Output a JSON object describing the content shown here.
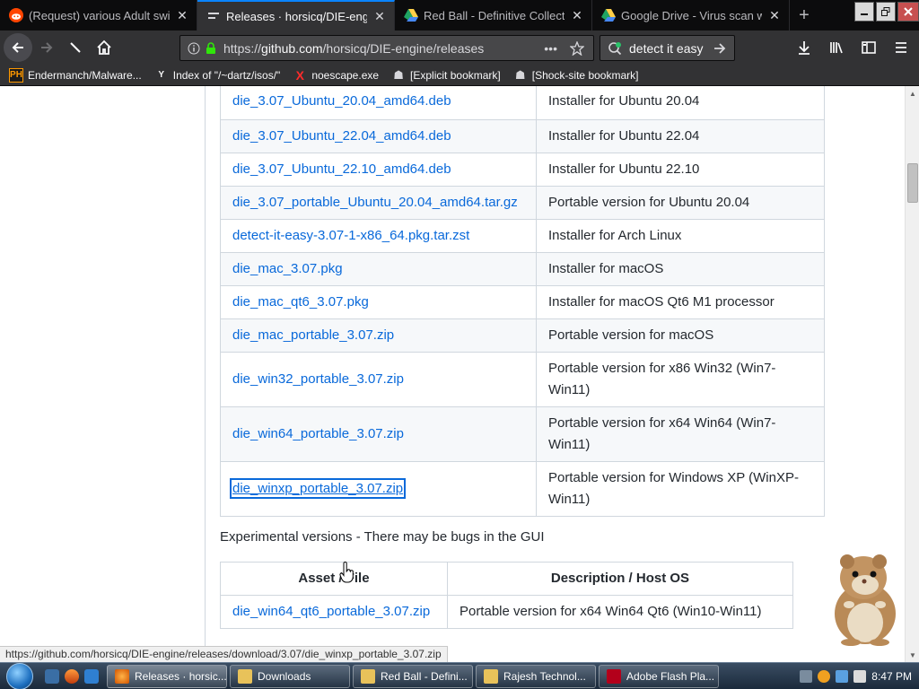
{
  "tabs": [
    {
      "title": "(Request) various Adult swim",
      "active": false,
      "icon": "reddit-icon"
    },
    {
      "title": "Releases · horsicq/DIE-engine",
      "active": true,
      "icon": "github-icon"
    },
    {
      "title": "Red Ball - Definitive Collectio",
      "active": false,
      "icon": "google-drive-icon"
    },
    {
      "title": "Google Drive - Virus scan war",
      "active": false,
      "icon": "google-drive-icon"
    }
  ],
  "tab_close_glyph": "✕",
  "new_tab_glyph": "+",
  "nav": {
    "url_prefix": "https://",
    "url_host": "github.com",
    "url_path": "/horsicq/DIE-engine/releases",
    "search_text": "detect it easy",
    "page_actions_glyph": "•••"
  },
  "bookmarks": [
    {
      "label": "Endermanch/Malware...",
      "icon": "pornhub-style-icon",
      "icon_text": "PH"
    },
    {
      "label": "Index of \"/~dartz/isos/\"",
      "icon": "y-icon",
      "icon_text": "Y"
    },
    {
      "label": "noescape.exe",
      "icon": "red-x-icon",
      "icon_text": "X"
    },
    {
      "label": "[Explicit bookmark]",
      "icon": "bookmark-icon",
      "icon_text": "☗"
    },
    {
      "label": "[Shock-site bookmark]",
      "icon": "bookmark-icon",
      "icon_text": "☗"
    }
  ],
  "assets_table": {
    "rows": [
      {
        "file": "die_3.07_Ubuntu_20.04_amd64.deb",
        "desc": "Installer for Ubuntu 20.04"
      },
      {
        "file": "die_3.07_Ubuntu_22.04_amd64.deb",
        "desc": "Installer for Ubuntu 22.04"
      },
      {
        "file": "die_3.07_Ubuntu_22.10_amd64.deb",
        "desc": "Installer for Ubuntu 22.10"
      },
      {
        "file": "die_3.07_portable_Ubuntu_20.04_amd64.tar.gz",
        "desc": "Portable version for Ubuntu 20.04"
      },
      {
        "file": "detect-it-easy-3.07-1-x86_64.pkg.tar.zst",
        "desc": "Installer for Arch Linux"
      },
      {
        "file": "die_mac_3.07.pkg",
        "desc": "Installer for macOS"
      },
      {
        "file": "die_mac_qt6_3.07.pkg",
        "desc": "Installer for macOS Qt6 M1 processor"
      },
      {
        "file": "die_mac_portable_3.07.zip",
        "desc": "Portable version for macOS"
      },
      {
        "file": "die_win32_portable_3.07.zip",
        "desc": "Portable version for x86 Win32 (Win7-Win11)"
      },
      {
        "file": "die_win64_portable_3.07.zip",
        "desc": "Portable version for x64 Win64 (Win7-Win11)"
      },
      {
        "file": "die_winxp_portable_3.07.zip",
        "desc": "Portable version for Windows XP (WinXP-Win11)"
      }
    ]
  },
  "experimental": {
    "heading": "Experimental versions - There may be bugs in the GUI",
    "header_file": "Asset / File",
    "header_desc": "Description / Host OS",
    "rows": [
      {
        "file": "die_win64_qt6_portable_3.07.zip",
        "desc": "Portable version for x64 Win64 Qt6 (Win10-Win11)"
      }
    ]
  },
  "status_url": "https://github.com/horsicq/DIE-engine/releases/download/3.07/die_winxp_portable_3.07.zip",
  "taskbar": {
    "buttons": [
      {
        "label": "Releases · horsic...",
        "icon": "firefox-icon",
        "active": true
      },
      {
        "label": "Downloads",
        "icon": "folder-icon",
        "active": false
      },
      {
        "label": "Red Ball - Defini...",
        "icon": "folder-icon",
        "active": false
      },
      {
        "label": "Rajesh Technol...",
        "icon": "folder-icon",
        "active": false
      },
      {
        "label": "Adobe Flash Pla...",
        "icon": "flash-icon",
        "active": false
      }
    ],
    "clock": "8:47 PM"
  },
  "colors": {
    "link": "#0969da",
    "tab_accent": "#0a84ff",
    "chrome_dark": "#323234"
  }
}
